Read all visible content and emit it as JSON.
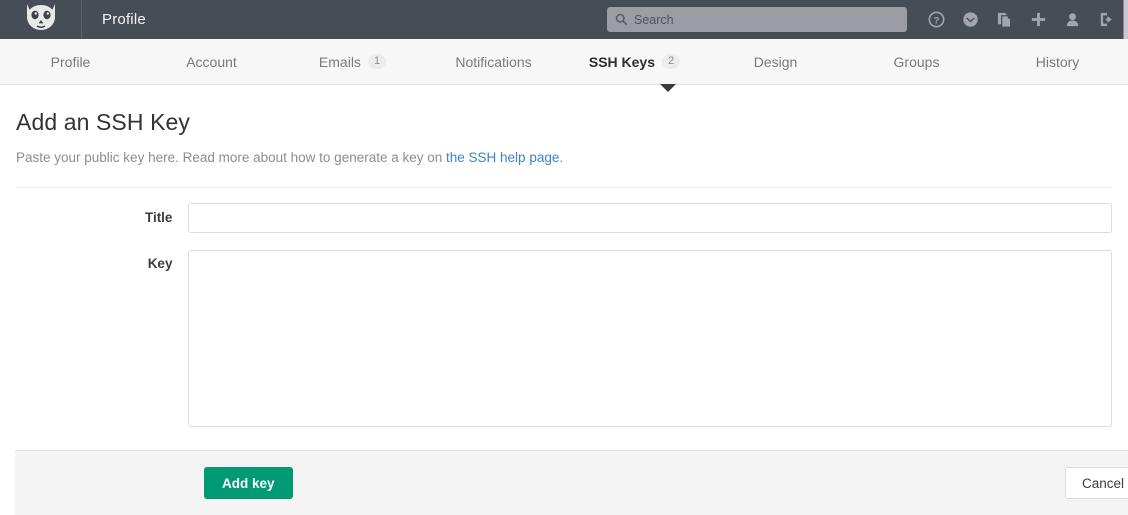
{
  "header": {
    "logo_icon": "gitlab-fox-logo",
    "app_title": "Profile",
    "search": {
      "placeholder": "Search",
      "value": "",
      "icon": "search-icon"
    },
    "icons": [
      {
        "name": "help-icon",
        "glyph": "?"
      },
      {
        "name": "explore-globe-icon",
        "glyph": ""
      },
      {
        "name": "snippets-file-icon",
        "glyph": ""
      },
      {
        "name": "new-plus-icon",
        "glyph": "+"
      },
      {
        "name": "user-profile-icon",
        "glyph": ""
      },
      {
        "name": "sign-out-icon",
        "glyph": ""
      }
    ],
    "colors": {
      "bar_background": "#474d57",
      "search_background": "#9a9da3"
    }
  },
  "nav": {
    "tabs": [
      {
        "label": "Profile",
        "badge": "",
        "active": false
      },
      {
        "label": "Account",
        "badge": "",
        "active": false
      },
      {
        "label": "Emails",
        "badge": "1",
        "active": false
      },
      {
        "label": "Notifications",
        "badge": "",
        "active": false
      },
      {
        "label": "SSH Keys",
        "badge": "2",
        "active": true
      },
      {
        "label": "Design",
        "badge": "",
        "active": false
      },
      {
        "label": "Groups",
        "badge": "",
        "active": false
      },
      {
        "label": "History",
        "badge": "",
        "active": false
      }
    ]
  },
  "main": {
    "title": "Add an SSH Key",
    "description_prefix": "Paste your public key here. Read more about how to generate a key on ",
    "description_link": "the SSH help page",
    "description_suffix": ".",
    "form": {
      "title_label": "Title",
      "title_value": "",
      "title_placeholder": "",
      "key_label": "Key",
      "key_value": "",
      "key_placeholder": ""
    },
    "actions": {
      "submit_label": "Add key",
      "cancel_label": "Cancel",
      "submit_color": "#009a74"
    }
  }
}
